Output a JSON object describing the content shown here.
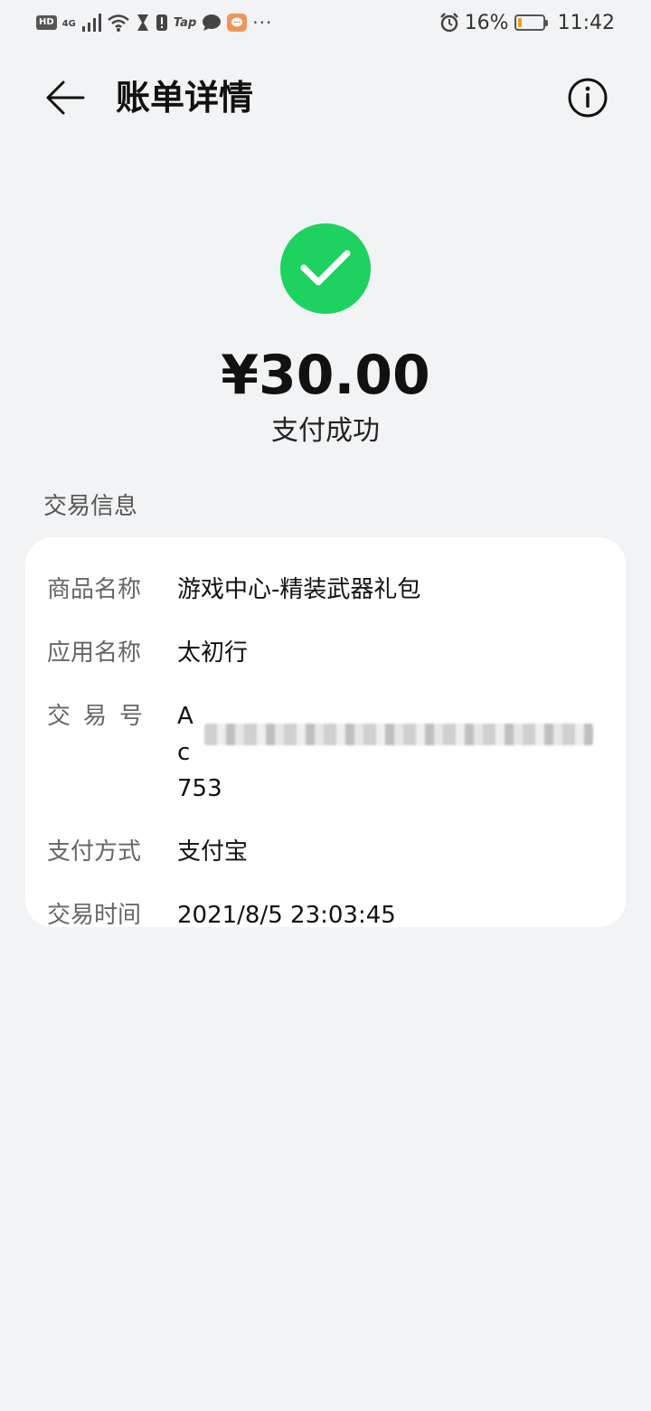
{
  "status_bar": {
    "hd": "HD",
    "network": "4G",
    "tap_label": "Tap",
    "battery_percent": "16%",
    "battery_level": 0.16,
    "time": "11:42",
    "icons": [
      "signal-icon",
      "wifi-icon",
      "hourglass-icon",
      "alert-icon",
      "chat-bubble-icon",
      "orange-chat-icon",
      "more-dots-icon",
      "alarm-icon",
      "battery-icon"
    ]
  },
  "header": {
    "title": "账单详情",
    "back_icon": "back-arrow-icon",
    "info_icon": "info-icon"
  },
  "summary": {
    "amount": "¥30.00",
    "status": "支付成功",
    "status_color": "#1dd25e"
  },
  "section": {
    "title": "交易信息"
  },
  "details": {
    "product_label": "商品名称",
    "product_value": "游戏中心-精装武器礼包",
    "app_label": "应用名称",
    "app_value": "太初行",
    "txn_label": "交易号",
    "txn_value_visible": "Ac",
    "txn_value_tail": "753",
    "method_label": "支付方式",
    "method_value": "支付宝",
    "time_label": "交易时间",
    "time_value": "2021/8/5 23:03:45"
  }
}
